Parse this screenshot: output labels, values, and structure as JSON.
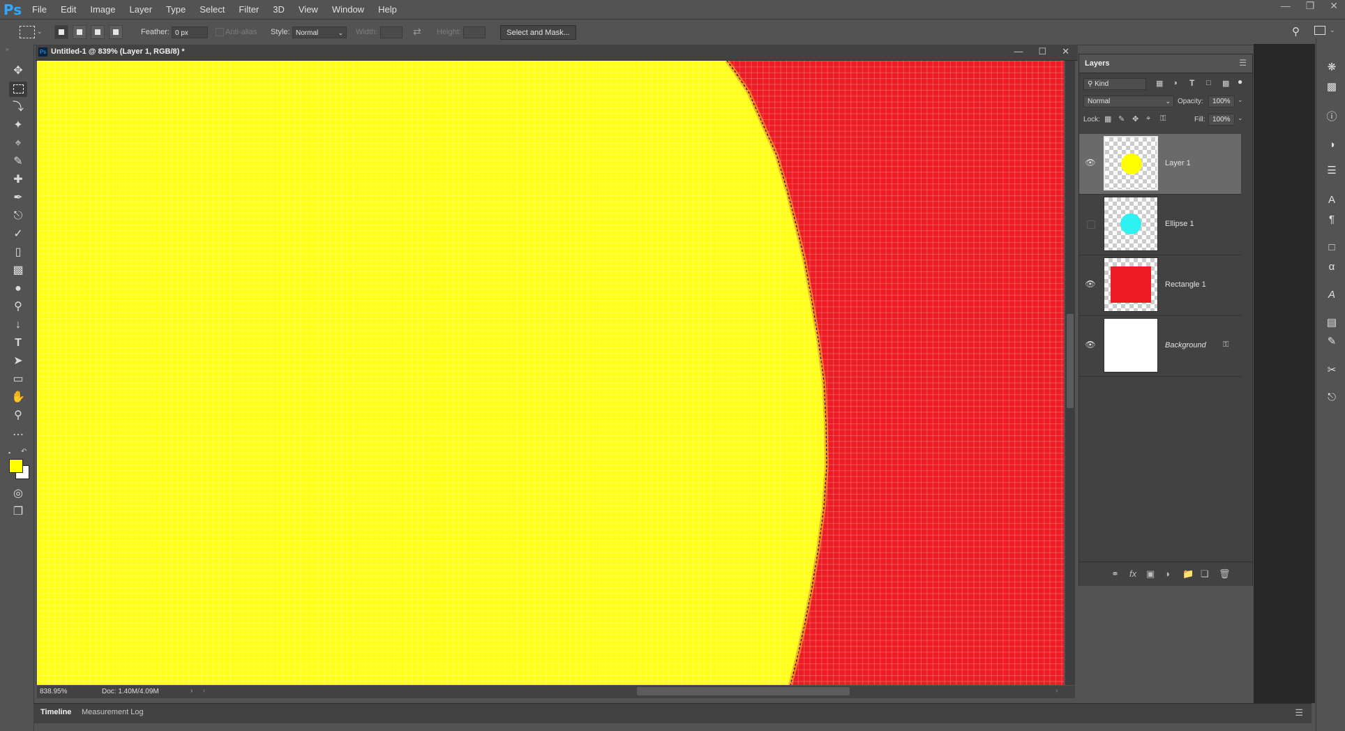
{
  "app": {
    "logo": "Ps"
  },
  "menu": [
    "File",
    "Edit",
    "Image",
    "Layer",
    "Type",
    "Select",
    "Filter",
    "3D",
    "View",
    "Window",
    "Help"
  ],
  "options": {
    "feather_label": "Feather:",
    "feather_value": "0 px",
    "antialias_label": "Anti-alias",
    "style_label": "Style:",
    "style_value": "Normal",
    "width_label": "Width:",
    "height_label": "Height:",
    "select_mask_label": "Select and Mask..."
  },
  "document": {
    "title": "Untitled-1 @ 839% (Layer 1, RGB/8) *",
    "zoom": "838.95%",
    "doc_info": "Doc: 1.40M/4.09M",
    "foreground_color": "#ffff00",
    "background_color": "#ffffff",
    "canvas_colors": {
      "selection": "#ffff1a",
      "background_layer": "#ed1c24"
    }
  },
  "layers_panel": {
    "tab_label": "Layers",
    "kind_filter": "Kind",
    "blend_mode": "Normal",
    "opacity_label": "Opacity:",
    "opacity_value": "100%",
    "lock_label": "Lock:",
    "fill_label": "Fill:",
    "fill_value": "100%",
    "layers": [
      {
        "name": "Layer 1",
        "visible": true,
        "selected": true,
        "thumb": "yellow-circle"
      },
      {
        "name": "Ellipse 1",
        "visible": false,
        "selected": false,
        "thumb": "cyan-circle"
      },
      {
        "name": "Rectangle 1",
        "visible": true,
        "selected": false,
        "thumb": "red-rect"
      },
      {
        "name": "Background",
        "visible": true,
        "selected": false,
        "thumb": "white",
        "locked": true
      }
    ]
  },
  "bottom_tabs": [
    "Timeline",
    "Measurement Log"
  ]
}
